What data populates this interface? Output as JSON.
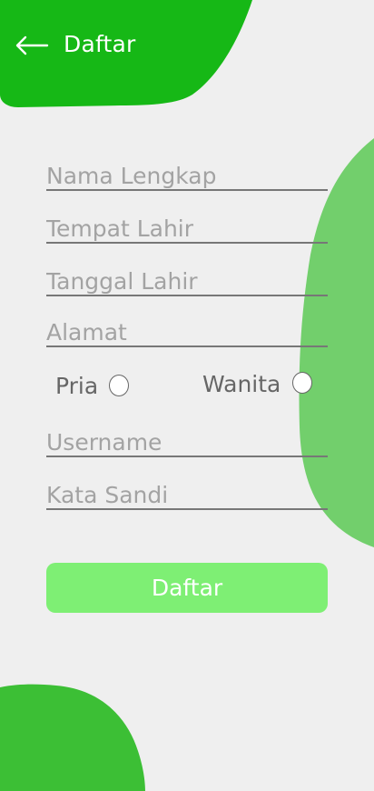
{
  "colors": {
    "background": "#efefef",
    "header_blob": "#16b816",
    "right_blob": "#72cf6c",
    "bottom_blob": "#3cbf35",
    "button": "#7eef74"
  },
  "header": {
    "title": "Daftar",
    "back_icon": "arrow-left-icon"
  },
  "form": {
    "full_name": {
      "placeholder": "Nama Lengkap",
      "value": ""
    },
    "birth_place": {
      "placeholder": "Tempat Lahir",
      "value": ""
    },
    "birth_date": {
      "placeholder": "Tanggal Lahir",
      "value": ""
    },
    "address": {
      "placeholder": "Alamat",
      "value": ""
    },
    "gender": {
      "male_label": "Pria",
      "female_label": "Wanita",
      "selected": ""
    },
    "username": {
      "placeholder": "Username",
      "value": ""
    },
    "password": {
      "placeholder": "Kata Sandi",
      "value": ""
    },
    "submit_label": "Daftar"
  }
}
